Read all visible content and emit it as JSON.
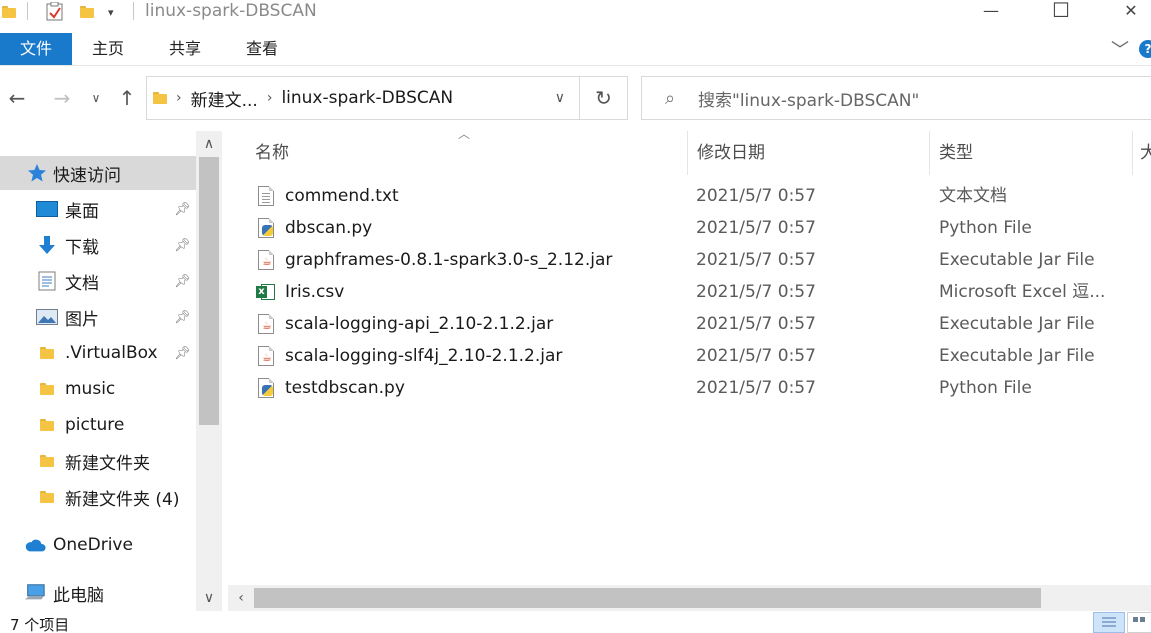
{
  "window": {
    "title": "linux-spark-DBSCAN",
    "minimize_glyph": "—",
    "maximize_glyph": "☐",
    "close_glyph": "✕"
  },
  "ribbon": {
    "tabs": [
      "文件",
      "主页",
      "共享",
      "查看"
    ],
    "help": "?"
  },
  "address": {
    "breadcrumbs": [
      "新建文...",
      "linux-spark-DBSCAN"
    ]
  },
  "search": {
    "placeholder": "搜索\"linux-spark-DBSCAN\""
  },
  "nav": {
    "items": [
      {
        "label": "快速访问",
        "icon": "star-icon",
        "pinned": false,
        "selected": true
      },
      {
        "label": "桌面",
        "icon": "desktop-icon",
        "pinned": true
      },
      {
        "label": "下载",
        "icon": "download-icon",
        "pinned": true
      },
      {
        "label": "文档",
        "icon": "documents-icon",
        "pinned": true
      },
      {
        "label": "图片",
        "icon": "pictures-icon",
        "pinned": true
      },
      {
        "label": ".VirtualBox",
        "icon": "folder-icon",
        "pinned": true
      },
      {
        "label": "music",
        "icon": "folder-icon",
        "pinned": false
      },
      {
        "label": "picture",
        "icon": "folder-icon",
        "pinned": false
      },
      {
        "label": "新建文件夹",
        "icon": "folder-icon",
        "pinned": false
      },
      {
        "label": "新建文件夹 (4)",
        "icon": "folder-icon",
        "pinned": false
      },
      {
        "label": "OneDrive",
        "icon": "cloud-icon",
        "pinned": false
      },
      {
        "label": "此电脑",
        "icon": "computer-icon",
        "pinned": false
      }
    ]
  },
  "filelist": {
    "columns": {
      "name": "名称",
      "modified": "修改日期",
      "type": "类型",
      "size": "大"
    },
    "files": [
      {
        "name": "commend.txt",
        "date": "2021/5/7 0:57",
        "type": "文本文档",
        "icon": "text-file-icon"
      },
      {
        "name": "dbscan.py",
        "date": "2021/5/7 0:57",
        "type": "Python File",
        "icon": "python-file-icon"
      },
      {
        "name": "graphframes-0.8.1-spark3.0-s_2.12.jar",
        "date": "2021/5/7 0:57",
        "type": "Executable Jar File",
        "icon": "jar-file-icon"
      },
      {
        "name": "Iris.csv",
        "date": "2021/5/7 0:57",
        "type": "Microsoft Excel 逗...",
        "icon": "excel-file-icon"
      },
      {
        "name": "scala-logging-api_2.10-2.1.2.jar",
        "date": "2021/5/7 0:57",
        "type": "Executable Jar File",
        "icon": "jar-file-icon"
      },
      {
        "name": "scala-logging-slf4j_2.10-2.1.2.jar",
        "date": "2021/5/7 0:57",
        "type": "Executable Jar File",
        "icon": "jar-file-icon"
      },
      {
        "name": "testdbscan.py",
        "date": "2021/5/7 0:57",
        "type": "Python File",
        "icon": "python-file-icon"
      }
    ]
  },
  "status": {
    "item_count": "7 个项目"
  },
  "colors": {
    "accent": "#1979ca",
    "selected_nav": "#d9d9d9",
    "folder": "#f5c442"
  }
}
